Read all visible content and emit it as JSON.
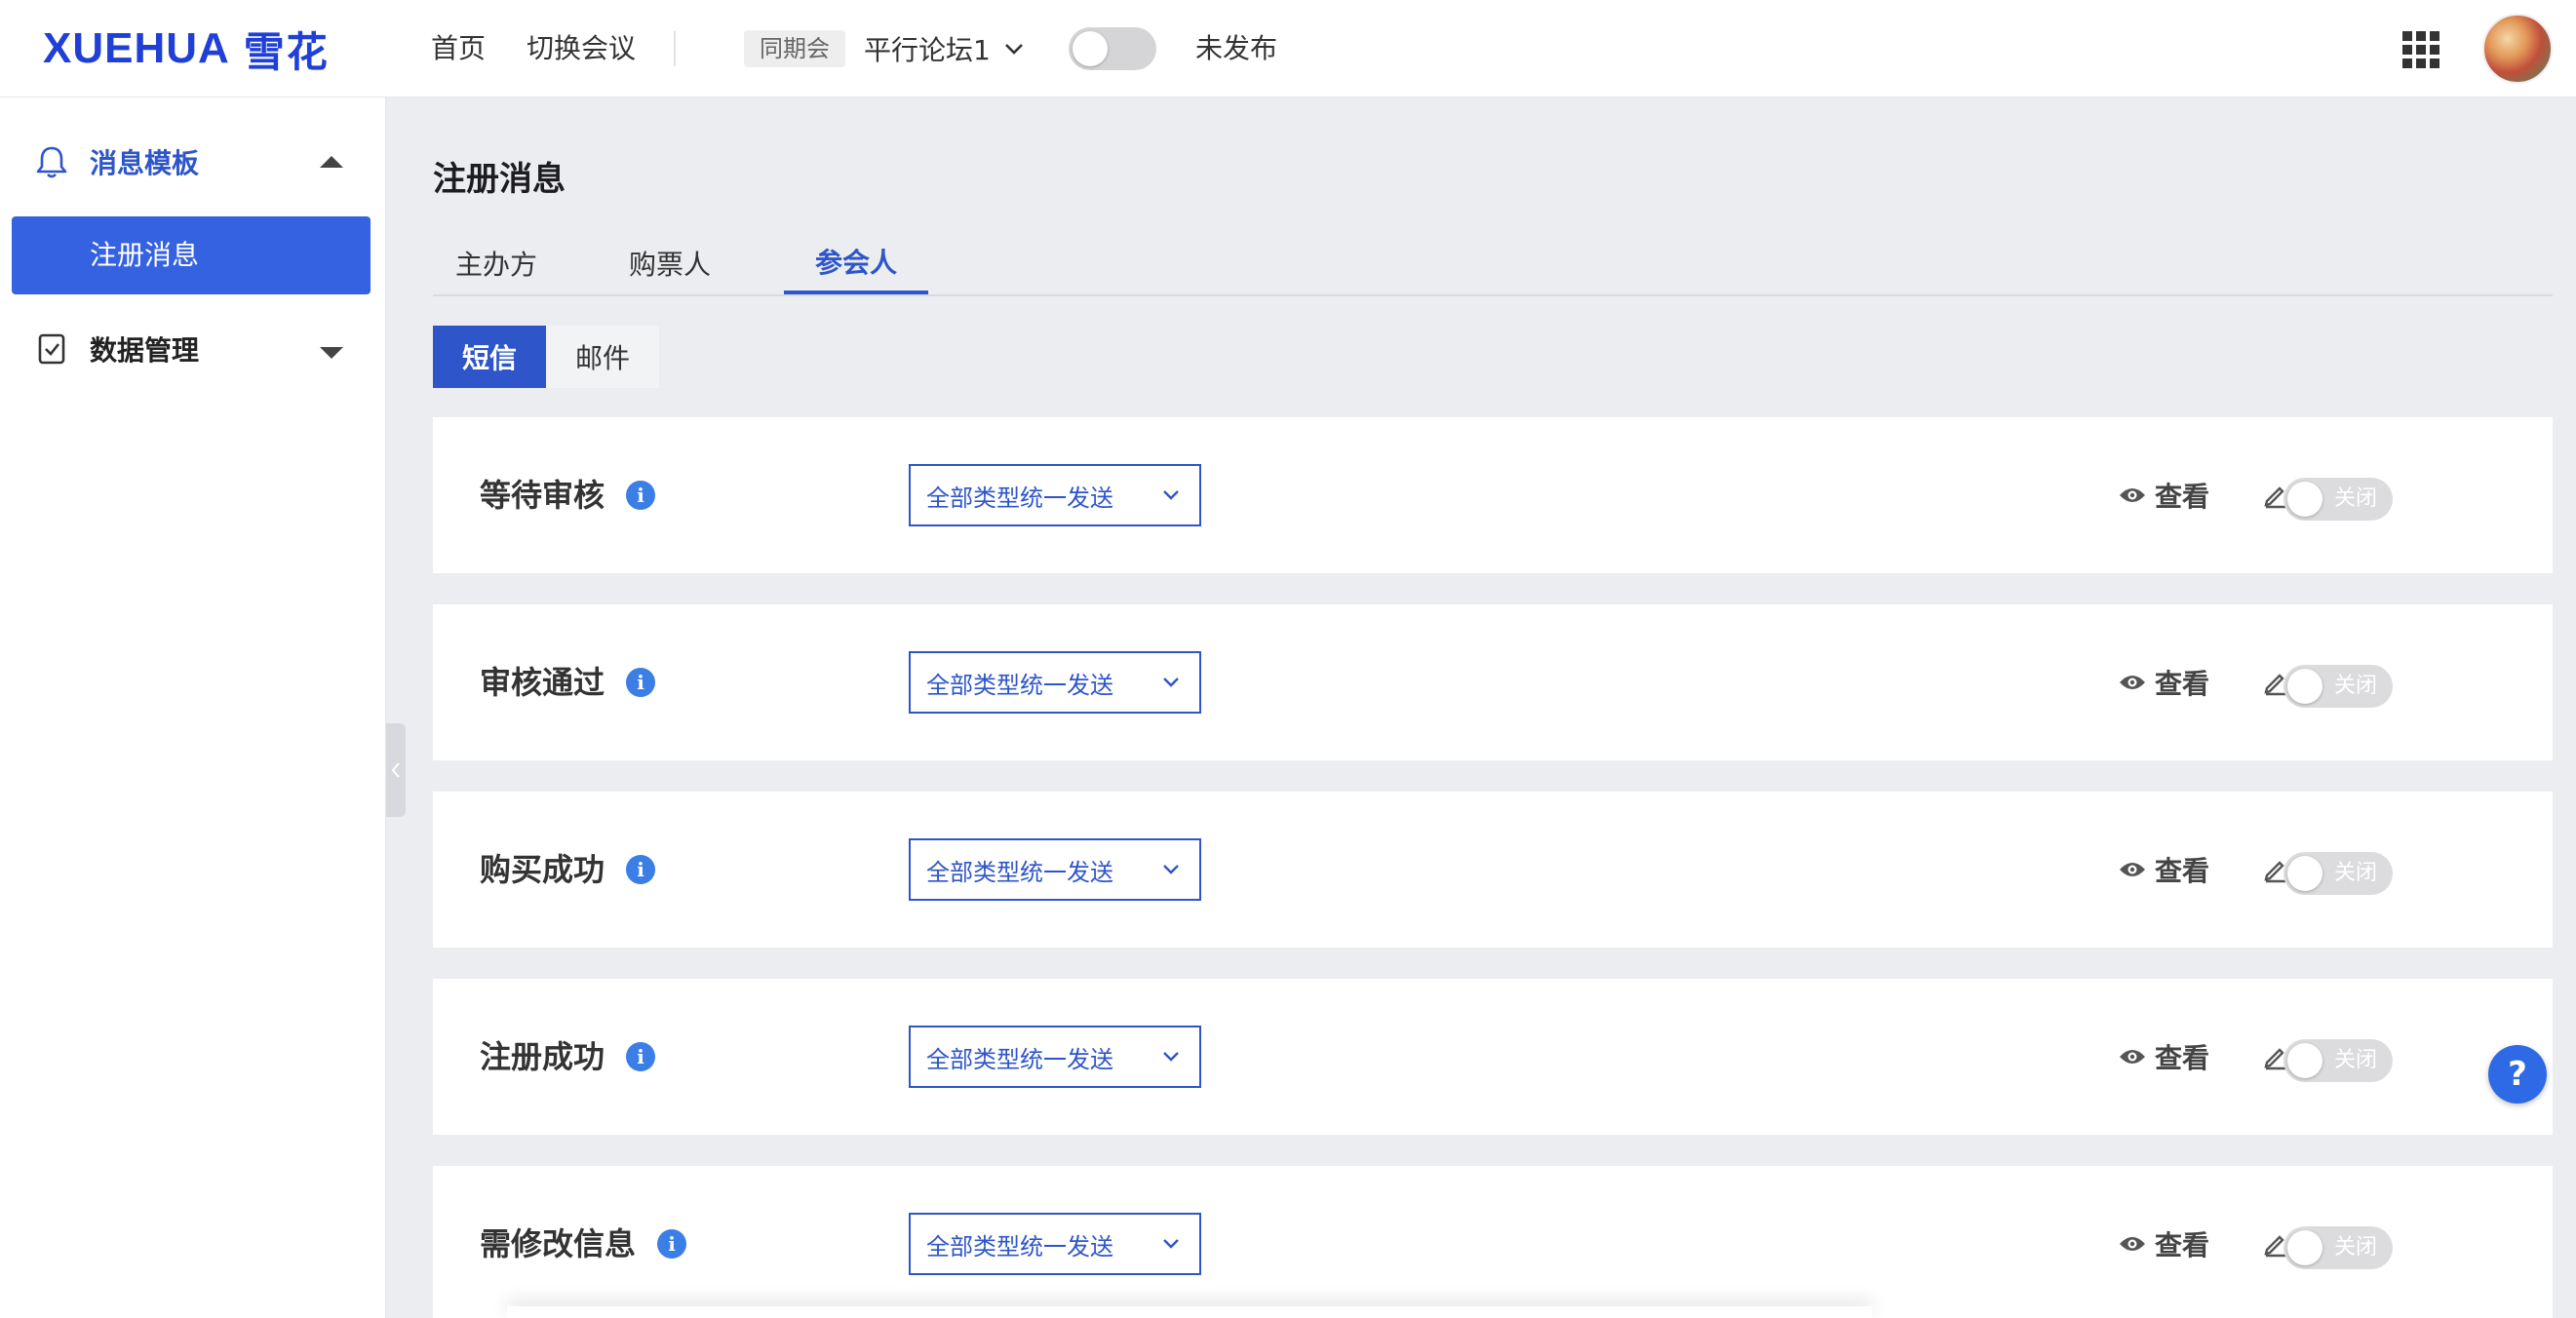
{
  "header": {
    "logo_latin": "XUEHUA",
    "logo_cn": "雪花",
    "nav_home": "首页",
    "nav_switch": "切换会议",
    "tag_same_period": "同期会",
    "conference_name": "平行论坛1",
    "publish_status": "未发布"
  },
  "sidebar": {
    "group1_label": "消息模板",
    "group1_active_item": "注册消息",
    "group2_label": "数据管理"
  },
  "main": {
    "title": "注册消息",
    "tabs": [
      "主办方",
      "购票人",
      "参会人"
    ],
    "active_tab": "参会人",
    "channels": [
      "短信",
      "邮件"
    ],
    "active_channel": "短信"
  },
  "templates": [
    {
      "title": "等待审核",
      "send_mode": "全部类型统一发送",
      "view": "查看",
      "edit": "编辑",
      "switch": "关闭"
    },
    {
      "title": "审核通过",
      "send_mode": "全部类型统一发送",
      "view": "查看",
      "edit": "编辑",
      "switch": "关闭"
    },
    {
      "title": "购买成功",
      "send_mode": "全部类型统一发送",
      "view": "查看",
      "edit": "编辑",
      "switch": "关闭"
    },
    {
      "title": "注册成功",
      "send_mode": "全部类型统一发送",
      "view": "查看",
      "edit": "编辑",
      "switch": "关闭"
    },
    {
      "title": "需修改信息",
      "send_mode": "全部类型统一发送",
      "view": "查看",
      "edit": "编辑",
      "switch": "关闭"
    }
  ],
  "help_label": "?",
  "colors": {
    "primary": "#2e55c9",
    "sidebar_active": "#3562e0",
    "info": "#3a7ee6",
    "background": "#ecedf1"
  }
}
